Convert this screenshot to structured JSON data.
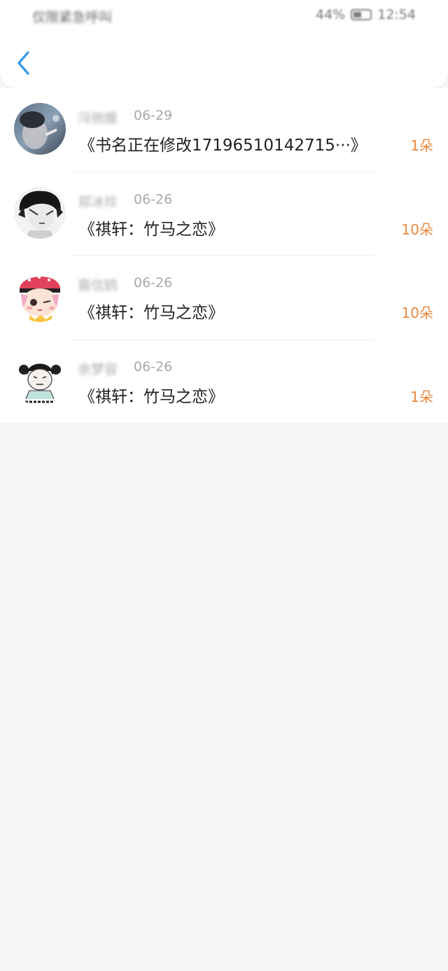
{
  "status_bar": {
    "left_text": "仅限紧急呼叫",
    "battery": "44%",
    "time": "12:54"
  },
  "header": {
    "back_icon": "chevron-left-icon",
    "accent_color": "#3a9be8"
  },
  "records": [
    {
      "name": "冯驰媛",
      "date": "06-29",
      "title": "《书名正在修改17196510142715···》",
      "count": "1朵",
      "avatar": "photo-avatar"
    },
    {
      "name": "郑冰珍",
      "date": "06-26",
      "title": "《祺轩：竹马之恋》",
      "count": "10朵",
      "avatar": "sketch-avatar"
    },
    {
      "name": "裔信鸥",
      "date": "06-26",
      "title": "《祺轩：竹马之恋》",
      "count": "10朵",
      "avatar": "cartoon-girl-avatar"
    },
    {
      "name": "余梦容",
      "date": "06-26",
      "title": "《祺轩：竹马之恋》",
      "count": "1朵",
      "avatar": "meme-avatar"
    }
  ],
  "colors": {
    "count_color": "#e8893e",
    "date_color": "#a8a8a8",
    "page_background": "#f7f6f7"
  }
}
